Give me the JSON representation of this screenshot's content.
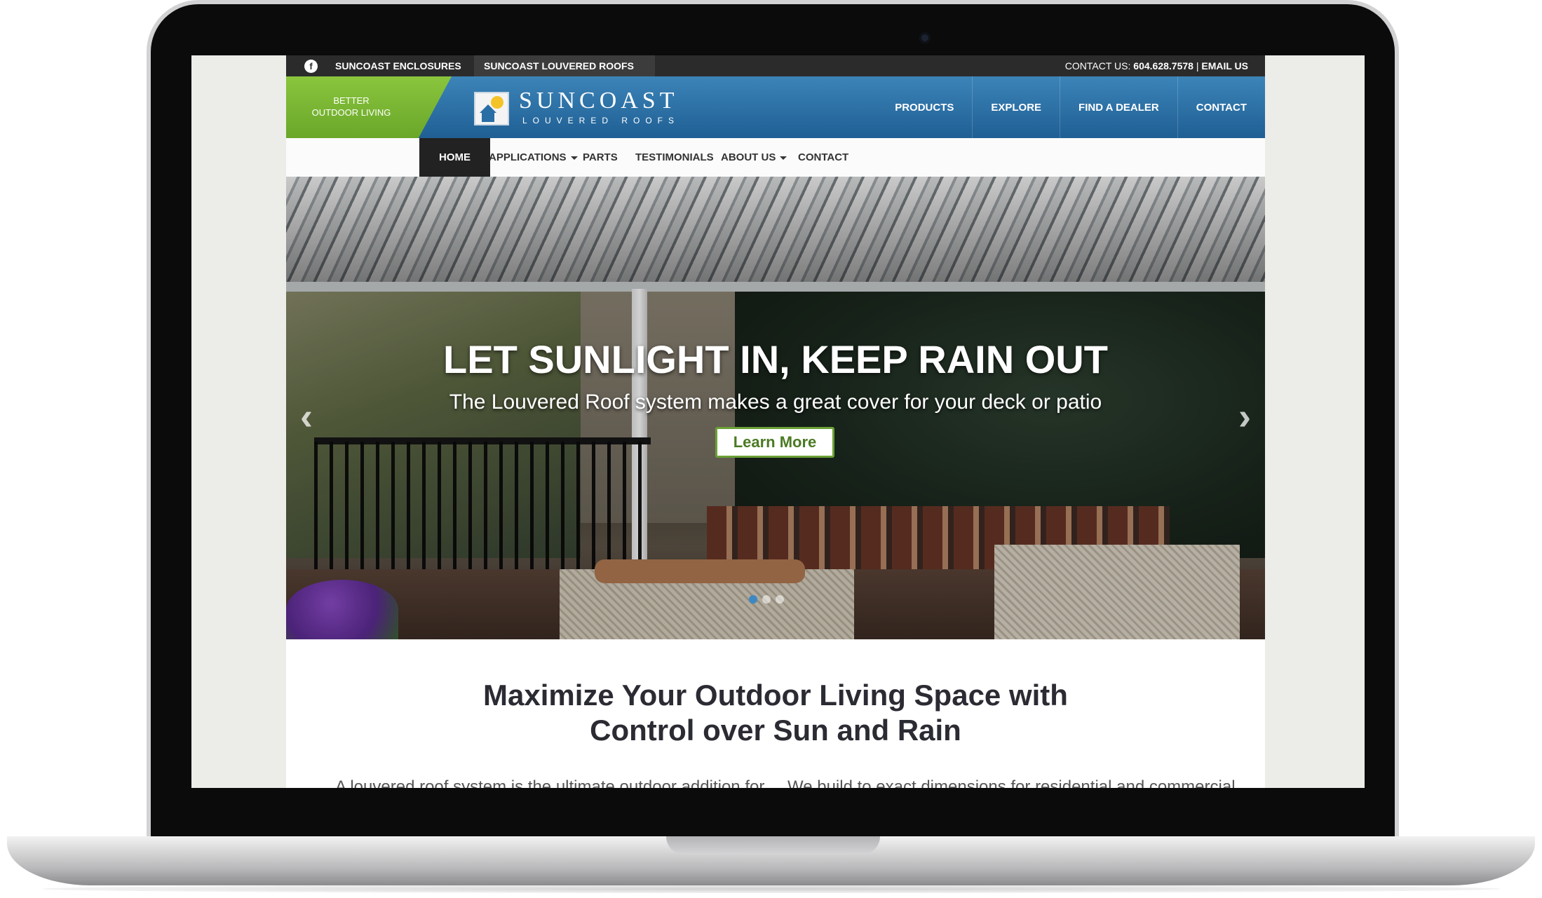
{
  "topbar": {
    "facebook_glyph": "f",
    "link1": "SUNCOAST ENCLOSURES",
    "link2": "SUNCOAST LOUVERED ROOFS",
    "contact_label": "CONTACT US:",
    "phone": "604.628.7578",
    "separator": "|",
    "email_label": "EMAIL US"
  },
  "header": {
    "tagline_line1": "BETTER",
    "tagline_line2": "OUTDOOR LIVING",
    "brand_name": "SUNCOAST",
    "brand_sub": "LOUVERED ROOFS",
    "nav": [
      {
        "label": "PRODUCTS"
      },
      {
        "label": "EXPLORE"
      },
      {
        "label": "FIND A DEALER"
      },
      {
        "label": "CONTACT"
      }
    ]
  },
  "subnav": {
    "items": [
      {
        "label": "HOME",
        "active": true
      },
      {
        "label": "APPLICATIONS",
        "dropdown": true
      },
      {
        "label": "PARTS"
      },
      {
        "label": "TESTIMONIALS"
      },
      {
        "label": "ABOUT US",
        "dropdown": true
      },
      {
        "label": "CONTACT"
      }
    ]
  },
  "hero": {
    "title": "LET SUNLIGHT IN, KEEP RAIN OUT",
    "subtitle": "The Louvered Roof system makes a great cover for your deck or patio",
    "button": "Learn More",
    "prev_glyph": "‹",
    "next_glyph": "›",
    "slides_total": 3,
    "active_slide": 1
  },
  "intro": {
    "title_line1": "Maximize Your Outdoor Living Space with",
    "title_line2": "Control over Sun and Rain",
    "col1": "A louvered roof system is the ultimate outdoor addition for",
    "col2": "We build to exact dimensions for residential and commercial"
  },
  "colors": {
    "accent_green": "#6aa72a",
    "header_blue": "#2a6ea6",
    "dot_active": "#3d88c3",
    "topbar": "#2b2b2b"
  }
}
